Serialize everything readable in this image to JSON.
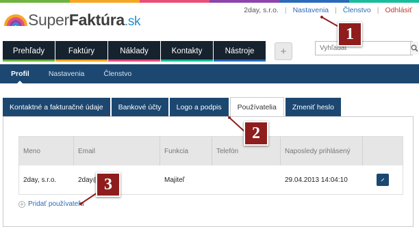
{
  "brand": {
    "name_light": "Super",
    "name_bold": "Faktúra",
    "name_tld": ".sk",
    "stripe_colors": [
      "#6db33f",
      "#f5a623",
      "#e94e77",
      "#8e44ad",
      "#2a6ab8",
      "#1abc9c"
    ],
    "logo_colors": [
      "#f5a623",
      "#e94e77",
      "#8e44ad",
      "#2a8fd0"
    ]
  },
  "user_bar": {
    "company": "2day, s.r.o.",
    "separator": "|",
    "settings": "Nastavenia",
    "membership": "Členstvo",
    "logout": "Odhlásiť"
  },
  "main_nav": {
    "tabs": [
      {
        "label": "Prehľady",
        "color": "#6db33f"
      },
      {
        "label": "Faktúry",
        "color": "#f5a623"
      },
      {
        "label": "Náklady",
        "color": "#e94e77"
      },
      {
        "label": "Kontakty",
        "color": "#1abc9c"
      },
      {
        "label": "Nástroje",
        "color": "#2a6ab8"
      }
    ],
    "add_label": "+"
  },
  "search": {
    "placeholder": "Vyhľadať"
  },
  "sub_nav": {
    "items": [
      "Profil",
      "Nastavenia",
      "Členstvo"
    ],
    "active": "Profil"
  },
  "profile_tabs": {
    "items": [
      "Kontaktné a fakturačné údaje",
      "Bankové účty",
      "Logo a podpis",
      "Používatelia",
      "Zmeniť heslo"
    ],
    "active": "Používatelia"
  },
  "users_table": {
    "headers": [
      "Meno",
      "Email",
      "Funkcia",
      "Telefón",
      "Naposledy prihlásený",
      ""
    ],
    "rows": [
      {
        "name": "2day, s.r.o.",
        "email": "2day@",
        "role": "Majiteľ",
        "phone": "",
        "last_login": "29.04.2013 14:04:10"
      }
    ]
  },
  "add_user": {
    "label": "Pridať používateľa",
    "icon_glyph": "+"
  },
  "markers": [
    "1",
    "2",
    "3"
  ],
  "accent": "#1c4770",
  "marker_color": "#8f1d1d"
}
